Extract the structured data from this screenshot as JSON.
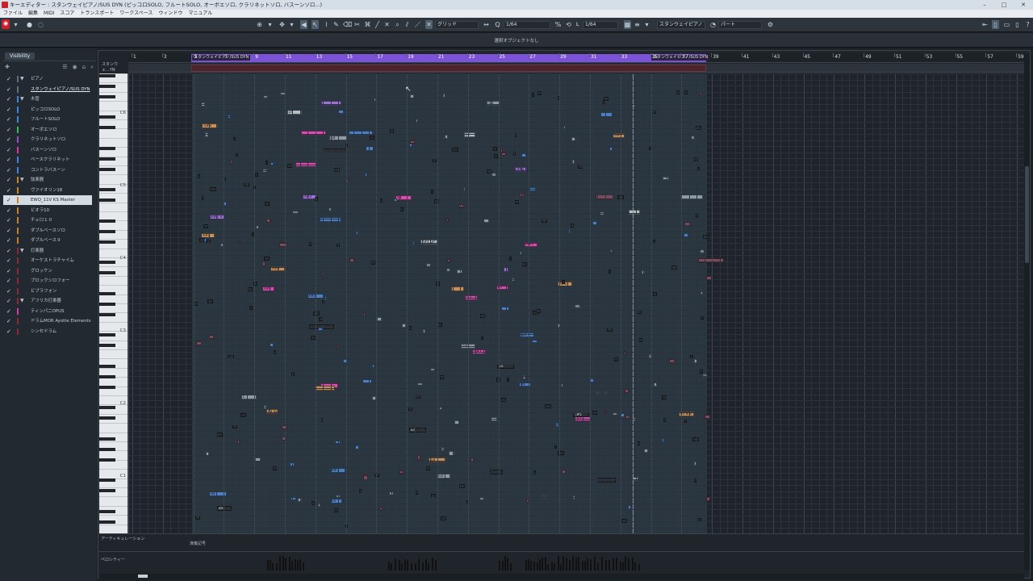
{
  "window": {
    "title": "キーエディター : スタンウェイピアノ/SUS DYN (ピッコロSOLO, フルートSOLO, オーボエソロ, クラリネットソロ, バスーンソロ...)"
  },
  "menu": [
    "ファイル",
    "編集",
    "MIDI",
    "スコア",
    "トランスポート",
    "ワークスペース",
    "ウィンドウ",
    "マニュアル"
  ],
  "toolbar": {
    "quantize_value": "1/64",
    "snap_type": "グリッド",
    "length_value": "1/64",
    "length_prefix": "L",
    "instrument_select": "スタンウェイピアノ",
    "part_select": "パート"
  },
  "infoline": {
    "text": "選択オブジェクトなし"
  },
  "inspector": {
    "tab_label": "Visibility",
    "tracks": [
      {
        "label": "ピアノ",
        "color": "#5f6f7c",
        "folder": true,
        "selected": false,
        "underline": false
      },
      {
        "label": "スタンウェイピアノ/SUS DYN",
        "color": "#5f6f7c",
        "folder": false,
        "selected": false,
        "underline": true
      },
      {
        "label": "木管",
        "color": "#3f86d8",
        "folder": true,
        "selected": false,
        "underline": false
      },
      {
        "label": "ピッコロSOLO",
        "color": "#3f86d8",
        "folder": false,
        "selected": false,
        "underline": false
      },
      {
        "label": "フルートSOLO",
        "color": "#3f86d8",
        "folder": false,
        "selected": false,
        "underline": false
      },
      {
        "label": "オーボエソロ",
        "color": "#2fbf53",
        "folder": false,
        "selected": false,
        "underline": false
      },
      {
        "label": "クラリネットソロ",
        "color": "#9a4fd0",
        "folder": false,
        "selected": false,
        "underline": false
      },
      {
        "label": "バスーンソロ",
        "color": "#d23ca7",
        "folder": false,
        "selected": false,
        "underline": false
      },
      {
        "label": "ベースクラリネット",
        "color": "#3f86d8",
        "folder": false,
        "selected": false,
        "underline": false
      },
      {
        "label": "コントラバスーン",
        "color": "#3f86d8",
        "folder": false,
        "selected": false,
        "underline": false
      },
      {
        "label": "弦楽器",
        "color": "#c9802d",
        "folder": true,
        "selected": false,
        "underline": false
      },
      {
        "label": "ヴァイオリン18",
        "color": "#c9802d",
        "folder": false,
        "selected": false,
        "underline": false
      },
      {
        "label": "EWQ_11V KS Master",
        "color": "#c9802d",
        "folder": false,
        "selected": true,
        "underline": false
      },
      {
        "label": "ビオラ10",
        "color": "#c9802d",
        "folder": false,
        "selected": false,
        "underline": false
      },
      {
        "label": "チェロ１０",
        "color": "#c9802d",
        "folder": false,
        "selected": false,
        "underline": false
      },
      {
        "label": "ダブルベースソロ",
        "color": "#c9802d",
        "folder": false,
        "selected": false,
        "underline": false
      },
      {
        "label": "ダブルベース９",
        "color": "#c9802d",
        "folder": false,
        "selected": false,
        "underline": false
      },
      {
        "label": "打楽器",
        "color": "#8c2a34",
        "folder": true,
        "selected": false,
        "underline": false
      },
      {
        "label": "オーケストラチャイム",
        "color": "#8c2a34",
        "folder": false,
        "selected": false,
        "underline": false
      },
      {
        "label": "グロッケン",
        "color": "#8c2a34",
        "folder": false,
        "selected": false,
        "underline": false
      },
      {
        "label": "ブロックシロフォー",
        "color": "#8c2a34",
        "folder": false,
        "selected": false,
        "underline": false
      },
      {
        "label": "ビブラフォン",
        "color": "#8c2a34",
        "folder": false,
        "selected": false,
        "underline": false
      },
      {
        "label": "アフリカ打楽器",
        "color": "#8c2a34",
        "folder": true,
        "selected": false,
        "underline": false
      },
      {
        "label": "ティンパニOPUS",
        "color": "#d23ca7",
        "folder": false,
        "selected": false,
        "underline": false
      },
      {
        "label": "ドラムMOR Ayotte Elements",
        "color": "#8c2a34",
        "folder": false,
        "selected": false,
        "underline": false
      },
      {
        "label": "シンセドラム",
        "color": "#8c2a34",
        "folder": false,
        "selected": false,
        "underline": false
      }
    ]
  },
  "ruler": {
    "bars": [
      "1",
      "3",
      "5",
      "7",
      "9",
      "11",
      "13",
      "15",
      "17",
      "19",
      "21",
      "23",
      "25",
      "27",
      "29",
      "31",
      "33",
      "35",
      "37",
      "39",
      "41",
      "43",
      "45",
      "47",
      "49",
      "51",
      "53",
      "55",
      "57",
      "59"
    ],
    "event_left_label": "スタンウェイピアノ/SUS DYN",
    "event_right_label": "スタンウェイピアノ/SUS DYN"
  },
  "keyboard": {
    "track_label": "スタンウェ...YN",
    "octave_labels": [
      "C6",
      "C5",
      "C4",
      "C3",
      "C2",
      "C1"
    ]
  },
  "lanes": {
    "articulation_label": "アーティキュレーション",
    "articulation_text": "演奏記号",
    "velocity_label": "ベロシティー"
  },
  "notes": [
    [
      "#4d7ec0",
      ""
    ],
    [
      "#4d7ec0",
      ""
    ],
    [
      "#4d7ec0",
      ""
    ],
    [
      "#4d7ec0",
      ""
    ],
    [
      "#4d7ec0",
      "G4"
    ],
    [
      "#4d7ec0",
      "A4"
    ],
    [
      "#4d7ec0",
      "F4"
    ],
    [
      "#4d7ec0",
      ""
    ],
    [
      "#d64fae",
      "E5"
    ],
    [
      "#d64fae",
      ""
    ],
    [
      "#d64fae",
      ""
    ],
    [
      "#d64fae",
      "G3"
    ],
    [
      "#d64fae",
      "A3"
    ],
    [
      "#d64fae",
      "A#2"
    ],
    [
      "#d64fae",
      ""
    ],
    [
      "#c49060",
      "A#3"
    ],
    [
      "#c49060",
      ""
    ],
    [
      "#c49060",
      "A3 Sus"
    ],
    [
      "#c49060",
      "G3"
    ],
    [
      "#c49060",
      "E3 Sus"
    ],
    [
      "#c49060",
      "A#1"
    ],
    [
      "#c49060",
      ""
    ],
    [
      "#8e9aa6",
      "G4"
    ],
    [
      "#8e9aa6",
      "G4"
    ],
    [
      "#8e9aa6",
      "G4"
    ],
    [
      "#8e9aa6",
      "G4"
    ],
    [
      "#8e9aa6",
      "C"
    ],
    [
      "#8e9aa6",
      ""
    ],
    [
      "#8e9aa6",
      ""
    ],
    [
      "#8e9aa6",
      ""
    ],
    [
      "#9d6fd8",
      "A#3 Tr"
    ],
    [
      "#9d6fd8",
      "A#2"
    ],
    [
      "#9d6fd8",
      "A#2 Tr"
    ],
    [
      "#9d6fd8",
      ""
    ],
    [
      "#9d6fd8",
      ""
    ],
    [
      "#b4bcc4",
      "A#4 DP"
    ],
    [
      "#b4bcc4",
      ""
    ],
    [
      "#b4bcc4",
      "E5"
    ],
    [
      "#b4bcc4",
      "D5"
    ],
    [
      "#2b2f33",
      ""
    ],
    [
      "#2b2f33",
      ""
    ],
    [
      "#2b2f33",
      ""
    ],
    [
      "#2b2f33",
      ""
    ],
    [
      "#2b2f33",
      "G5"
    ],
    [
      "#2b2f33",
      "E5"
    ],
    [
      "#2b2f33",
      "D5"
    ],
    [
      "#2b2f33",
      "C#5"
    ],
    [
      "#4d7ec0",
      "A#3"
    ],
    [
      "#4d7ec0",
      "A#4"
    ],
    [
      "#4d7ec0",
      "A4"
    ],
    [
      "#4d7ec0",
      ""
    ],
    [
      "#4d7ec0",
      ""
    ],
    [
      "#d64fae",
      "A3"
    ],
    [
      "#d64fae",
      "G#3"
    ],
    [
      "#d64fae",
      "A#1"
    ],
    [
      "#c49060",
      "G#3"
    ],
    [
      "#c49060",
      "A#3"
    ],
    [
      "#c49060",
      "G#3"
    ],
    [
      "#7a4b5a",
      ""
    ],
    [
      "#7a4b5a",
      ""
    ],
    [
      "#7a4b5a",
      ""
    ],
    [
      "#7a4b5a",
      ""
    ],
    [
      "#7a4b5a",
      ""
    ],
    [
      "#7a4b5a",
      ""
    ]
  ],
  "colors": {
    "accent": "#7c52d8",
    "record": "#c8202c",
    "selected_track": "#d3dbe3"
  }
}
